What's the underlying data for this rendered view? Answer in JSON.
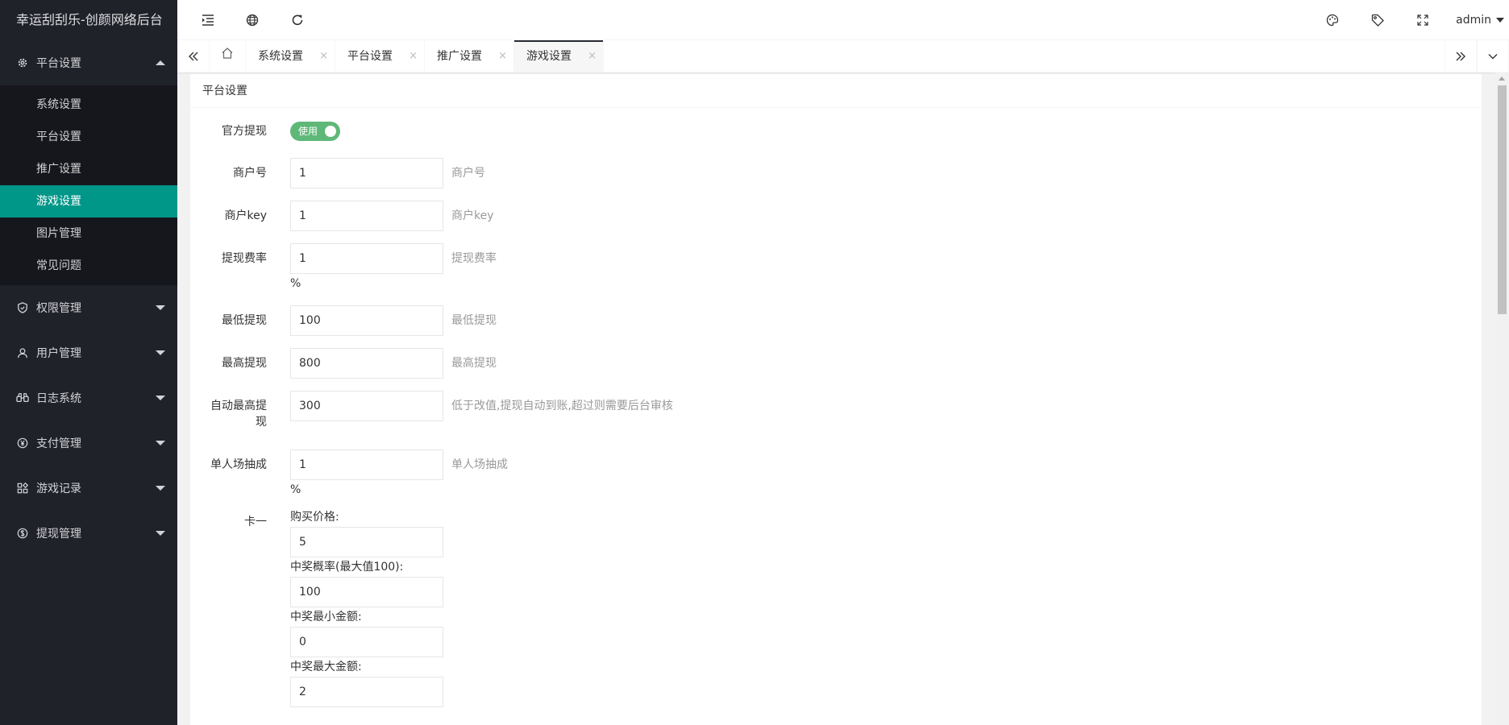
{
  "app": {
    "title": "幸运刮刮乐-创颜网络后台"
  },
  "sidebar": {
    "groups": [
      {
        "label": "平台设置",
        "icon": "gear-icon",
        "expanded": true,
        "items": [
          "系统设置",
          "平台设置",
          "推广设置",
          "游戏设置",
          "图片管理",
          "常见问题"
        ],
        "active_item": "游戏设置"
      },
      {
        "label": "权限管理",
        "icon": "shield-icon"
      },
      {
        "label": "用户管理",
        "icon": "user-icon"
      },
      {
        "label": "日志系统",
        "icon": "binoculars-icon"
      },
      {
        "label": "支付管理",
        "icon": "yen-icon"
      },
      {
        "label": "游戏记录",
        "icon": "apps-icon"
      },
      {
        "label": "提现管理",
        "icon": "dollar-icon"
      }
    ]
  },
  "header": {
    "left_icons": [
      "menu-fold-icon",
      "globe-icon",
      "refresh-icon"
    ],
    "right_icons": [
      "theme-icon",
      "tag-icon",
      "fullscreen-icon"
    ],
    "user": "admin"
  },
  "tabs": {
    "items": [
      "系统设置",
      "平台设置",
      "推广设置",
      "游戏设置"
    ],
    "active": "游戏设置",
    "close_glyph": "×"
  },
  "card": {
    "title": "平台设置"
  },
  "form": {
    "official_withdraw": {
      "label": "官方提现",
      "switch_text": "使用",
      "on": true
    },
    "merchant_no": {
      "label": "商户号",
      "value": "1",
      "hint": "商户号"
    },
    "merchant_key": {
      "label": "商户key",
      "value": "1",
      "hint": "商户key"
    },
    "withdraw_rate": {
      "label": "提现费率",
      "value": "1",
      "hint": "提现费率",
      "unit": "%"
    },
    "min_withdraw": {
      "label": "最低提现",
      "value": "100",
      "hint": "最低提现"
    },
    "max_withdraw": {
      "label": "最高提现",
      "value": "800",
      "hint": "最高提现"
    },
    "auto_max_withdraw": {
      "label_line1": "自动最高提",
      "label_line2": "现",
      "value": "300",
      "hint": "低于改值,提现自动到账,超过则需要后台审核"
    },
    "single_cut": {
      "label": "单人场抽成",
      "value": "1",
      "hint": "单人场抽成",
      "unit": "%"
    },
    "card1": {
      "label": "卡一",
      "price_label": "购买价格:",
      "price": "5",
      "prob_label": "中奖概率(最大值100):",
      "prob": "100",
      "min_label": "中奖最小金额:",
      "min": "0",
      "max_label": "中奖最大金额:",
      "max": "2"
    }
  },
  "colors": {
    "sidebar_bg": "#20222a",
    "active": "#009688",
    "switch_on": "#5fb878"
  }
}
